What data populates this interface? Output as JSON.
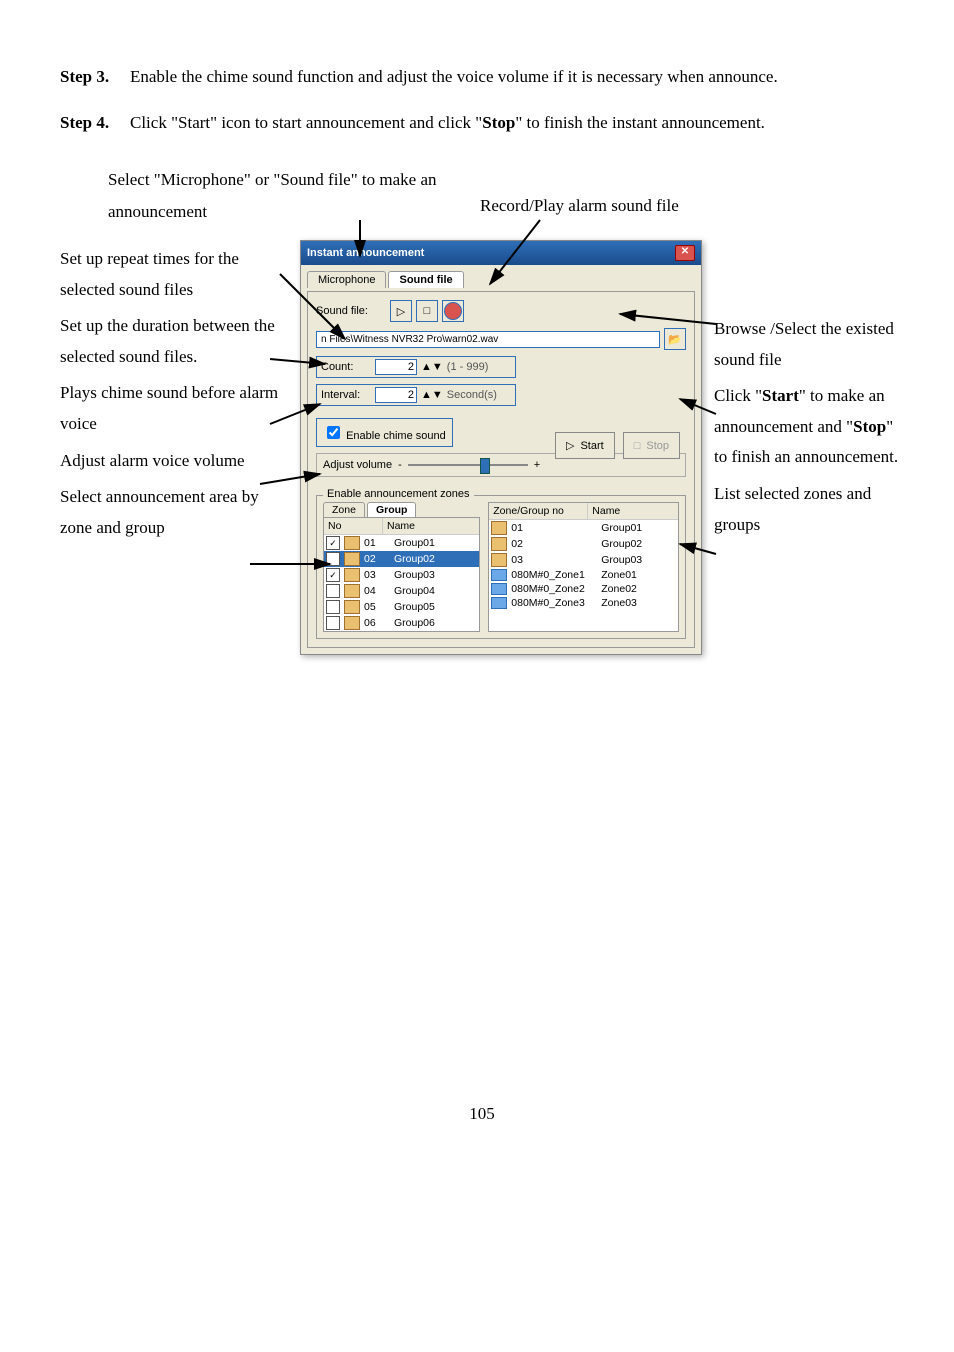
{
  "steps": [
    {
      "label": "Step 3.",
      "body_parts": [
        "Enable the chime sound function and adjust the voice volume if it is necessary when announce."
      ]
    },
    {
      "label": "Step 4.",
      "body_parts": [
        "Click \"Start\" icon to start announcement and click \"",
        "Stop",
        "\" to finish the instant announcement."
      ]
    }
  ],
  "top_labels": {
    "left": "Select \"Microphone\" or \"Sound file\" to make an announcement",
    "right": "Record/Play alarm sound file"
  },
  "left_callouts": [
    "Set up repeat times for the selected sound files",
    "Set up the duration between the selected sound files.",
    "Plays chime sound before alarm voice",
    "Adjust alarm voice volume",
    "Select announcement area by zone and group"
  ],
  "right_callouts": [
    "Browse /Select the existed sound file",
    "Click \"Start\" to make an announcement and \"Stop\" to finish an announcement.",
    "List selected zones and groups"
  ],
  "dialog": {
    "title": "Instant announcement",
    "tabs": [
      "Microphone",
      "Sound file"
    ],
    "active_tab": "Sound file",
    "sound_file_label": "Sound file:",
    "sound_file_path": "n Files\\Witness NVR32 Pro\\warn02.wav",
    "count_label": "Count:",
    "count_value": "2",
    "count_hint": "(1 - 999)",
    "interval_label": "Interval:",
    "interval_value": "2",
    "interval_unit": "Second(s)",
    "chime_label": "Enable chime sound",
    "volume_label": "Adjust volume",
    "volume_min": "-",
    "volume_max": "+",
    "start_label": "Start",
    "stop_label": "Stop",
    "zones_legend": "Enable announcement zones",
    "zone_tabs": [
      "Zone",
      "Group"
    ],
    "zone_active_tab": "Group",
    "left_header": [
      "No",
      "Name"
    ],
    "left_rows": [
      {
        "checked": true,
        "no": "01",
        "name": "Group01",
        "hl": false
      },
      {
        "checked": true,
        "no": "02",
        "name": "Group02",
        "hl": true
      },
      {
        "checked": true,
        "no": "03",
        "name": "Group03",
        "hl": false
      },
      {
        "checked": false,
        "no": "04",
        "name": "Group04",
        "hl": false
      },
      {
        "checked": false,
        "no": "05",
        "name": "Group05",
        "hl": false
      },
      {
        "checked": false,
        "no": "06",
        "name": "Group06",
        "hl": false
      }
    ],
    "right_header": [
      "Zone/Group no",
      "Name"
    ],
    "right_rows": [
      {
        "type": "group",
        "id": "01",
        "name": "Group01"
      },
      {
        "type": "group",
        "id": "02",
        "name": "Group02"
      },
      {
        "type": "group",
        "id": "03",
        "name": "Group03"
      },
      {
        "type": "zone",
        "id": "080M#0_Zone1",
        "name": "Zone01"
      },
      {
        "type": "zone",
        "id": "080M#0_Zone2",
        "name": "Zone02"
      },
      {
        "type": "zone",
        "id": "080M#0_Zone3",
        "name": "Zone03"
      }
    ]
  },
  "pagenum": "105"
}
